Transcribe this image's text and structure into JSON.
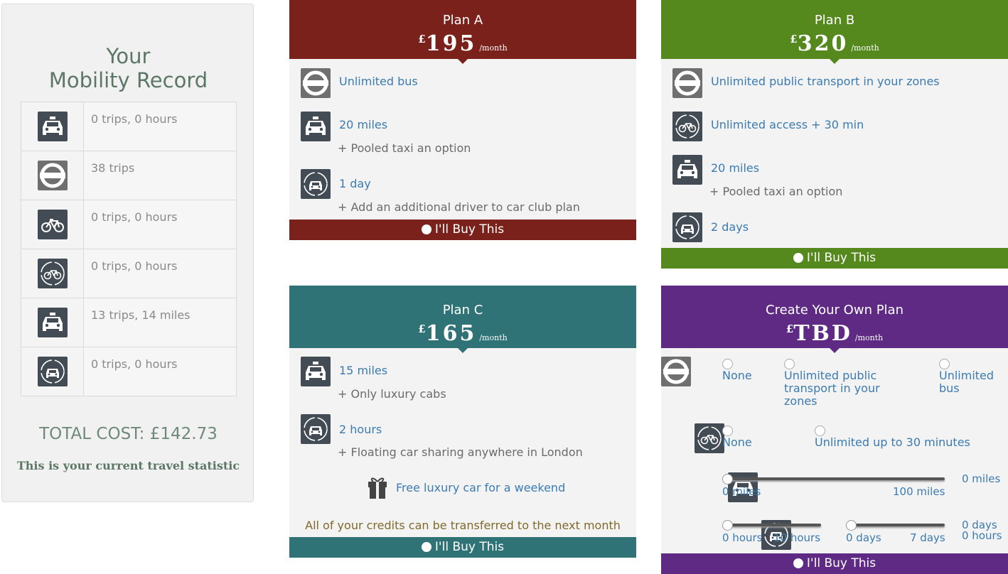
{
  "record": {
    "title_line1": "Your",
    "title_line2": "Mobility Record",
    "rows": [
      {
        "icon": "taxi-icon",
        "text": "0 trips, 0 hours"
      },
      {
        "icon": "underground-icon",
        "text": "38 trips"
      },
      {
        "icon": "bike-icon",
        "text": "0 trips, 0 hours"
      },
      {
        "icon": "bike-share-icon",
        "text": "0 trips, 0 hours"
      },
      {
        "icon": "taxi-icon",
        "text": "13 trips, 14 miles"
      },
      {
        "icon": "car-club-icon",
        "text": "0 trips, 0 hours"
      }
    ],
    "total": "TOTAL COST: £142.73",
    "note": "This is your current travel statistic"
  },
  "plans": {
    "a": {
      "name": "Plan A",
      "currency": "£",
      "price": "195",
      "per": "/month",
      "color": "#7b211b",
      "items": [
        {
          "icon": "underground-icon",
          "main": "Unlimited bus",
          "sub": ""
        },
        {
          "icon": "taxi-icon",
          "main": "20 miles",
          "sub": "+ Pooled taxi an option"
        },
        {
          "icon": "car-club-icon",
          "main": "1 day",
          "sub": "+ Add an additional driver to car club plan"
        }
      ],
      "buy": "I'll Buy This"
    },
    "b": {
      "name": "Plan B",
      "currency": "£",
      "price": "320",
      "per": "/month",
      "color": "#55891e",
      "items": [
        {
          "icon": "underground-icon",
          "main": "Unlimited public transport in your zones",
          "sub": ""
        },
        {
          "icon": "bike-share-icon",
          "main": "Unlimited access + 30 min",
          "sub": ""
        },
        {
          "icon": "taxi-icon",
          "main": "20 miles",
          "sub": "+ Pooled taxi an option"
        },
        {
          "icon": "car-club-icon",
          "main": "2 days",
          "sub": ""
        }
      ],
      "buy": "I'll Buy This"
    },
    "c": {
      "name": "Plan C",
      "currency": "£",
      "price": "165",
      "per": "/month",
      "color": "#2f7377",
      "items": [
        {
          "icon": "taxi-icon",
          "main": "15 miles",
          "sub": "+ Only luxury cabs"
        },
        {
          "icon": "car-club-icon",
          "main": "2 hours",
          "sub": "+ Floating car sharing anywhere in London"
        }
      ],
      "gift": "Free luxury car for a weekend",
      "credits": "All of your credits can be transferred to the next month",
      "buy": "I'll Buy This"
    },
    "d": {
      "name": "Create Your Own Plan",
      "currency": "£",
      "price": "TBD",
      "per": "/month",
      "color": "#5e2a84",
      "transit_options": [
        "None",
        "Unlimited public transport in your zones",
        "Unlimited bus"
      ],
      "bike_options": [
        "None",
        "Unlimited up to 30 minutes"
      ],
      "taxi": {
        "min": "0 miles",
        "max": "100 miles",
        "value": "0 miles",
        "fraction": 0
      },
      "car_hours": {
        "min": "0 hours",
        "max": "10 hours",
        "fraction": 0
      },
      "car_days": {
        "min": "0 days",
        "max": "7 days",
        "fraction": 0
      },
      "car_value_days": "0 days",
      "car_value_hours": "0 hours",
      "buy": "I'll Buy This"
    }
  }
}
